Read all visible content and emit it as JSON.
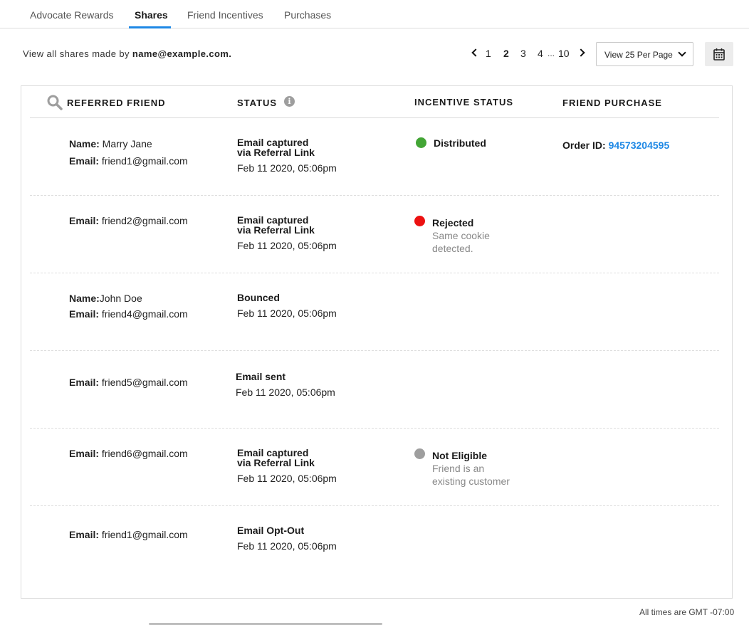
{
  "tabs": [
    {
      "label": "Advocate Rewards",
      "active": false
    },
    {
      "label": "Shares",
      "active": true
    },
    {
      "label": "Friend Incentives",
      "active": false
    },
    {
      "label": "Purchases",
      "active": false
    }
  ],
  "info": {
    "prefix": "View all shares made by ",
    "email": "name@example.com."
  },
  "pagination": {
    "pages": [
      "1",
      "2",
      "3",
      "4"
    ],
    "current": "2",
    "ellipsis": "...",
    "last": "10",
    "per_page": "View 25 Per Page"
  },
  "table": {
    "headers": {
      "referred_friend": "REFERRED FRIEND",
      "status": "STATUS",
      "incentive_status": "INCENTIVE STATUS",
      "friend_purchase": "FRIEND PURCHASE"
    },
    "labels": {
      "name": "Name:",
      "email": "Email:",
      "order_id": "Order ID:"
    },
    "rows": [
      {
        "name": " Marry Jane",
        "email": " friend1@gmail.com",
        "status_line1": "Email captured",
        "status_line2": "via Referral Link",
        "date": "Feb 11 2020,  05:06pm",
        "incentive": "Distributed",
        "incentive_color": "#43a535",
        "order_id": "94573204595"
      },
      {
        "email": " friend2@gmail.com",
        "status_line1": "Email captured",
        "status_line2": "via Referral Link",
        "date": "Feb 11 2020,  05:06pm",
        "incentive": "Rejected",
        "incentive_color": "#ec1111",
        "note_line1": "Same cookie",
        "note_line2": "detected."
      },
      {
        "name": "John Doe",
        "email": " friend4@gmail.com",
        "status_line1": "Bounced",
        "date": "Feb 11 2020,  05:06pm"
      },
      {
        "email": " friend5@gmail.com",
        "status_line1": "Email sent",
        "date": "Feb 11 2020,  05:06pm"
      },
      {
        "email": " friend6@gmail.com",
        "status_line1": "Email captured",
        "status_line2": "via Referral Link",
        "date": "Feb 11 2020,  05:06pm",
        "incentive": "Not Eligible",
        "incentive_color": "#9e9e9e",
        "note_line1": "Friend is an",
        "note_line2": "existing customer"
      },
      {
        "email": " friend1@gmail.com",
        "status_line1": "Email Opt-Out",
        "date": "Feb 11 2020,  05:06pm"
      }
    ]
  },
  "footer": {
    "timezone_note": "All times are GMT -07:00"
  }
}
